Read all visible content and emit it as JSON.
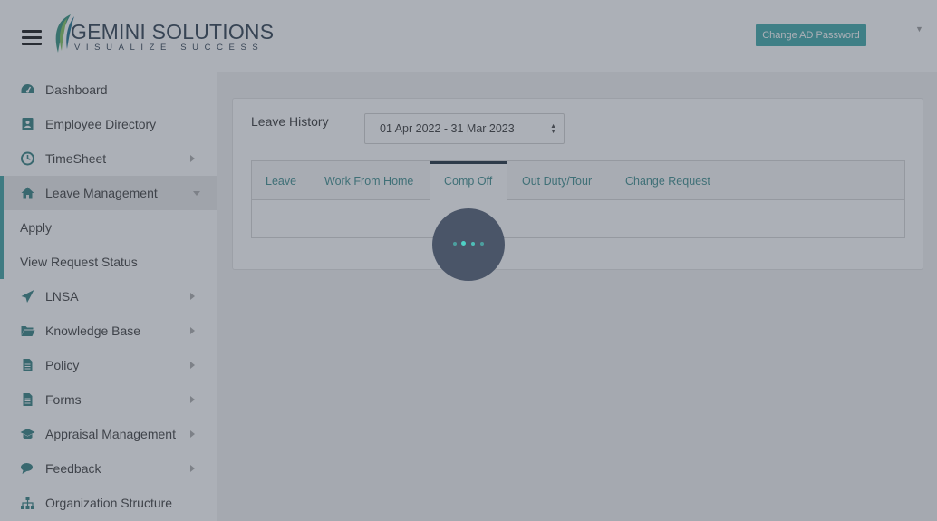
{
  "header": {
    "logo_title": "GEMINI SOLUTIONS",
    "logo_tagline": "VISUALIZE SUCCESS",
    "change_password_label": "Change AD Password"
  },
  "sidebar": {
    "items": [
      {
        "label": "Dashboard",
        "icon": "dashboard-icon"
      },
      {
        "label": "Employee Directory",
        "icon": "address-book-icon"
      },
      {
        "label": "TimeSheet",
        "icon": "clock-icon"
      },
      {
        "label": "Leave Management",
        "icon": "home-icon"
      },
      {
        "label": "LNSA",
        "icon": "paper-plane-icon"
      },
      {
        "label": "Knowledge Base",
        "icon": "folder-open-icon"
      },
      {
        "label": "Policy",
        "icon": "document-icon"
      },
      {
        "label": "Forms",
        "icon": "document-icon"
      },
      {
        "label": "Appraisal Management",
        "icon": "graduation-cap-icon"
      },
      {
        "label": "Feedback",
        "icon": "comments-icon"
      },
      {
        "label": "Organization Structure",
        "icon": "sitemap-icon"
      }
    ],
    "subitems": [
      {
        "label": "Apply"
      },
      {
        "label": "View Request Status"
      }
    ]
  },
  "main": {
    "leave_history_label": "Leave History",
    "period_select": {
      "value": "01 Apr 2022 - 31 Mar 2023"
    },
    "tabs": [
      {
        "label": "Leave"
      },
      {
        "label": "Work From Home"
      },
      {
        "label": "Comp Off"
      },
      {
        "label": "Out Duty/Tour"
      },
      {
        "label": "Change Request"
      }
    ],
    "active_tab": "Comp Off"
  },
  "colors": {
    "accent": "#3aa6a6",
    "tab_text": "#3a8a8a",
    "overlay": "#46505f",
    "spinner_dots": "#4fd1c5"
  }
}
